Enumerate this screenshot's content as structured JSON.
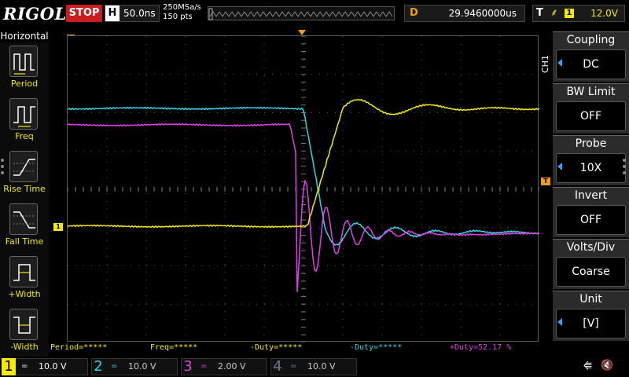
{
  "topbar": {
    "logo": "RIGOL",
    "run_state": "STOP",
    "timebase_label": "H",
    "timebase_value": "50.0ns",
    "sample_rate": "250MSa/s",
    "memory_depth": "150 pts",
    "delay_label": "D",
    "delay_value": "29.9460000us",
    "trigger_label": "T",
    "trigger_source": "1",
    "trigger_level": "12.0V"
  },
  "left_panel": {
    "title": "Horizontal",
    "items": [
      {
        "label": "Period",
        "icon": "period-icon"
      },
      {
        "label": "Freq",
        "icon": "frequency-icon"
      },
      {
        "label": "Rise Time",
        "icon": "rise-time-icon"
      },
      {
        "label": "Fall Time",
        "icon": "fall-time-icon"
      },
      {
        "label": "+Width",
        "icon": "positive-width-icon"
      },
      {
        "label": "-Width",
        "icon": "negative-width-icon"
      }
    ]
  },
  "measurements": [
    {
      "text": "Period=*****",
      "color": "#f5e90c"
    },
    {
      "text": "Freq=*****",
      "color": "#f5e90c"
    },
    {
      "text": "-Duty=*****",
      "color": "#f5e90c"
    },
    {
      "text": "-Duty=*****",
      "color": "#2fd6e8"
    },
    {
      "text": "+Duty=52.17 %",
      "color": "#e040e8"
    }
  ],
  "markers": {
    "ch1": "1",
    "trigger": "T",
    "trigger_position": "T"
  },
  "menu": {
    "channel_tab": "CH1",
    "items": [
      {
        "title": "Coupling",
        "value": "DC",
        "has_arrow": true
      },
      {
        "title": "BW Limit",
        "value": "OFF",
        "has_arrow": false
      },
      {
        "title": "Probe",
        "value": "10X",
        "has_arrow": true
      },
      {
        "title": "Invert",
        "value": "OFF",
        "has_arrow": false
      },
      {
        "title": "Volts/Div",
        "value": "Coarse",
        "has_arrow": false
      },
      {
        "title": "Unit",
        "value": "[V]",
        "has_arrow": true
      }
    ]
  },
  "channels": [
    {
      "number": "1",
      "coupling": "=",
      "scale": "10.0 V",
      "color": "#f5e90c",
      "active": true
    },
    {
      "number": "2",
      "coupling": "=",
      "scale": "10.0 V",
      "color": "#2fd6e8",
      "active": false
    },
    {
      "number": "3",
      "coupling": "=",
      "scale": "2.00 V",
      "color": "#e040e8",
      "active": false
    },
    {
      "number": "4",
      "coupling": "=",
      "scale": "10.0 V",
      "color": "#6c7a9c",
      "active": false
    }
  ],
  "status_icons": [
    "usb-icon",
    "speaker-muted-icon"
  ],
  "colors": {
    "ch1": "#f5e90c",
    "ch2": "#2fd6e8",
    "ch3": "#e040e8",
    "ch4": "#6c7a9c",
    "trigger": "#f39c12",
    "stop": "#c81e1e",
    "accent": "#2ea3ff"
  }
}
